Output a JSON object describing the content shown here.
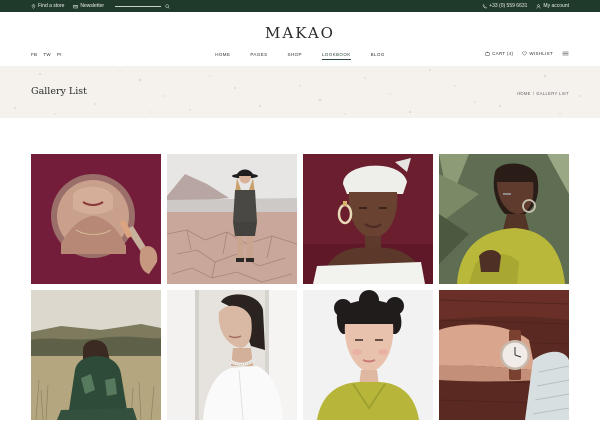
{
  "topbar": {
    "find_store": "Find a store",
    "newsletter": "Newsletter",
    "phone": "+33 (0) 559 6631",
    "account": "My account",
    "colors": {
      "bar": "#1f3a2a",
      "text": "#e8eee9"
    }
  },
  "header": {
    "logo": "MAKAO",
    "social": [
      "FB",
      "TW",
      "PI"
    ],
    "nav": [
      "HOME",
      "PAGES",
      "SHOP",
      "LOOKBOOK",
      "BLOG"
    ],
    "active_nav": "LOOKBOOK",
    "cart_label": "CART (4)",
    "wishlist_label": "WISHLIST"
  },
  "page": {
    "title": "Gallery List",
    "breadcrumb_home": "HOME",
    "breadcrumb_sep": "/",
    "breadcrumb_current": "GALLERY LIST"
  },
  "gallery": {
    "items": [
      {
        "name": "gallery-photo-1",
        "subject": "woman with hand mirror on burgundy"
      },
      {
        "name": "gallery-photo-2",
        "subject": "woman in hat on cracked desert"
      },
      {
        "name": "gallery-photo-3",
        "subject": "woman in white head wrap"
      },
      {
        "name": "gallery-photo-4",
        "subject": "woman in yellow top with leaves"
      },
      {
        "name": "gallery-photo-5",
        "subject": "woman in field from behind"
      },
      {
        "name": "gallery-photo-6",
        "subject": "woman with choker by window"
      },
      {
        "name": "gallery-photo-7",
        "subject": "woman in yellow jacket portrait"
      },
      {
        "name": "gallery-photo-8",
        "subject": "wrist with watch"
      }
    ]
  }
}
